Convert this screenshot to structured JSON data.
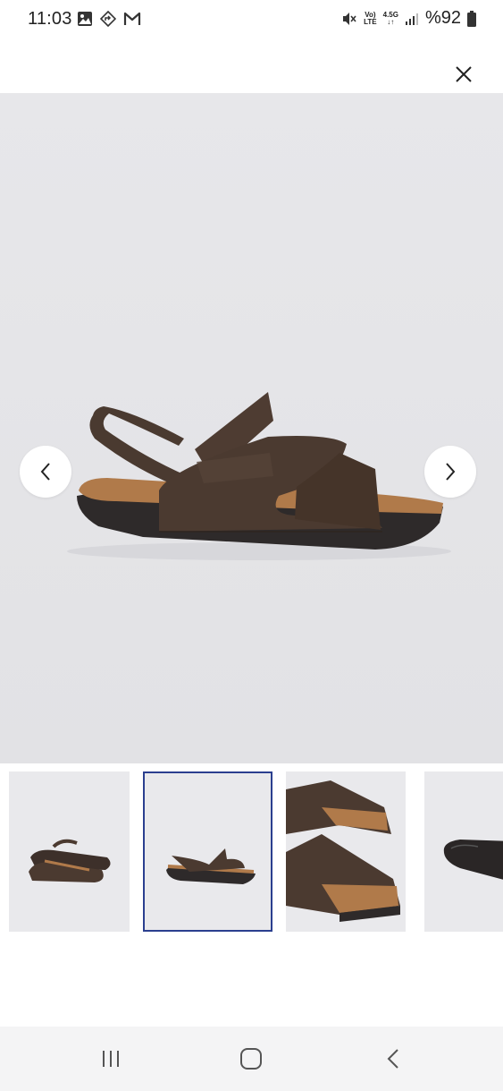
{
  "status_bar": {
    "time": "11:03",
    "left_icons": [
      "gallery-icon",
      "navigation-icon",
      "gmail-icon"
    ],
    "network_volte": "Vo)",
    "network_lte": "LTE",
    "network_type": "4.5G",
    "battery_text": "%92"
  },
  "header": {
    "close_icon": "close-icon"
  },
  "gallery": {
    "main_image": "brown-leather-sandal-side-view",
    "prev_icon": "chevron-left-icon",
    "next_icon": "chevron-right-icon",
    "background_color": "#e7e7ea",
    "selected_thumb_index": 1,
    "selected_border_color": "#2b3f8f",
    "thumbnails": [
      {
        "name": "sandals-pair-angle"
      },
      {
        "name": "sandal-side-view"
      },
      {
        "name": "sandals-closeup"
      },
      {
        "name": "sandal-sole"
      }
    ]
  },
  "system_nav": {
    "recents_icon": "recents-icon",
    "home_icon": "home-icon",
    "back_icon": "back-icon"
  }
}
